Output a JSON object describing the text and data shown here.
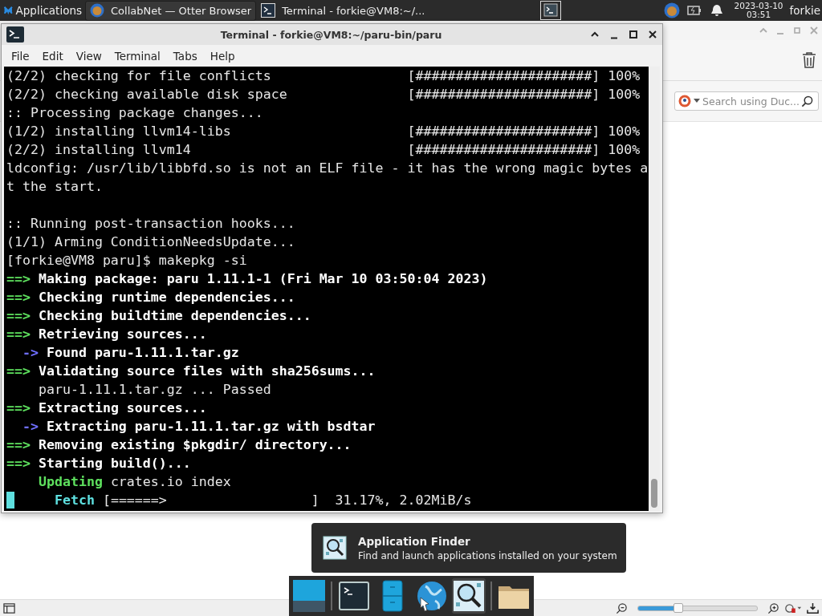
{
  "top_panel": {
    "apps_menu": "Applications",
    "tasks": [
      {
        "title": "CollabNet — Otter Browser",
        "kind": "browser",
        "selected": true
      },
      {
        "title": "Terminal - forkie@VM8:~/...",
        "kind": "terminal",
        "selected": false
      }
    ],
    "clock": {
      "date": "2023-03-10",
      "time": "03:51"
    },
    "user": "forkie"
  },
  "browser": {
    "search": {
      "placeholder": "Search using Duc..."
    },
    "zoom": {
      "level": 0.34
    }
  },
  "terminal": {
    "title": "Terminal - forkie@VM8:~/paru-bin/paru",
    "menu": [
      "File",
      "Edit",
      "View",
      "Terminal",
      "Tabs",
      "Help"
    ],
    "lines": [
      {
        "cursor": false,
        "segments": [
          {
            "text": "(2/2) checking for file conflicts                 [######################] 100%",
            "kind": "output"
          }
        ]
      },
      {
        "cursor": false,
        "segments": [
          {
            "text": "(2/2) checking available disk space               [######################] 100%",
            "kind": "output"
          }
        ]
      },
      {
        "cursor": false,
        "segments": [
          {
            "text": ":: Processing package changes...",
            "kind": "output"
          }
        ]
      },
      {
        "cursor": false,
        "segments": [
          {
            "text": "(1/2) installing llvm14-libs                      [######################] 100%",
            "kind": "output"
          }
        ]
      },
      {
        "cursor": false,
        "segments": [
          {
            "text": "(2/2) installing llvm14                           [######################] 100%",
            "kind": "output"
          }
        ]
      },
      {
        "cursor": false,
        "segments": [
          {
            "text": "ldconfig: /usr/lib/libbfd.so is not an ELF file - it has the wrong magic bytes a",
            "kind": "output"
          }
        ]
      },
      {
        "cursor": false,
        "segments": [
          {
            "text": "t the start.",
            "kind": "output"
          }
        ]
      },
      {
        "cursor": false
      },
      {
        "cursor": false,
        "segments": [
          {
            "text": ":: Running post-transaction hooks...",
            "kind": "output"
          }
        ]
      },
      {
        "cursor": false,
        "segments": [
          {
            "text": "(1/1) Arming ConditionNeedsUpdate...",
            "kind": "output"
          }
        ]
      },
      {
        "cursor": false,
        "segments": [
          {
            "text": "[forkie@VM8 paru]$ makepkg -si",
            "kind": "output"
          }
        ]
      },
      {
        "cursor": false,
        "segments": [
          {
            "text": "==>",
            "kind": "marker"
          },
          {
            "text": " Making package: paru 1.11.1-1 (Fri Mar 10 03:50:04 2023)",
            "kind": "heading"
          }
        ]
      },
      {
        "cursor": false,
        "segments": [
          {
            "text": "==>",
            "kind": "marker"
          },
          {
            "text": " Checking runtime dependencies...",
            "kind": "heading"
          }
        ]
      },
      {
        "cursor": false,
        "segments": [
          {
            "text": "==>",
            "kind": "marker"
          },
          {
            "text": " Checking buildtime dependencies...",
            "kind": "heading"
          }
        ]
      },
      {
        "cursor": false,
        "segments": [
          {
            "text": "==>",
            "kind": "marker"
          },
          {
            "text": " Retrieving sources...",
            "kind": "heading"
          }
        ]
      },
      {
        "cursor": false,
        "segments": [
          {
            "text": "  ->",
            "kind": "subarrow"
          },
          {
            "text": " Found paru-1.11.1.tar.gz",
            "kind": "heading"
          }
        ]
      },
      {
        "cursor": false,
        "segments": [
          {
            "text": "==>",
            "kind": "marker"
          },
          {
            "text": " Validating source files with sha256sums...",
            "kind": "heading"
          }
        ]
      },
      {
        "cursor": false,
        "segments": [
          {
            "text": "    paru-1.11.1.tar.gz ... Passed",
            "kind": "output"
          }
        ]
      },
      {
        "cursor": false,
        "segments": [
          {
            "text": "==>",
            "kind": "marker"
          },
          {
            "text": " Extracting sources...",
            "kind": "heading"
          }
        ]
      },
      {
        "cursor": false,
        "segments": [
          {
            "text": "  ->",
            "kind": "subarrow"
          },
          {
            "text": " Extracting paru-1.11.1.tar.gz with bsdtar",
            "kind": "heading"
          }
        ]
      },
      {
        "cursor": false,
        "segments": [
          {
            "text": "==>",
            "kind": "marker"
          },
          {
            "text": " Removing existing $pkgdir/ directory...",
            "kind": "heading"
          }
        ]
      },
      {
        "cursor": false,
        "segments": [
          {
            "text": "==>",
            "kind": "marker"
          },
          {
            "text": " Starting build()...",
            "kind": "heading"
          }
        ]
      },
      {
        "cursor": false,
        "segments": [
          {
            "text": "    Updating",
            "kind": "action"
          },
          {
            "text": " crates.io index",
            "kind": "output"
          }
        ]
      },
      {
        "cursor": true,
        "segments": [
          {
            "text": "      Fetch",
            "kind": "fetch"
          },
          {
            "text": " [======>                  ]  31.17%, 2.02MiB/s",
            "kind": "output"
          }
        ]
      }
    ]
  },
  "tooltip": {
    "title": "Application Finder",
    "description": "Find and launch applications installed on your system"
  },
  "dock": [
    {
      "kind": "desktop",
      "selected": false
    },
    {
      "kind": "terminal",
      "selected": false
    },
    {
      "kind": "cabinet",
      "selected": false
    },
    {
      "kind": "globe",
      "selected": false
    },
    {
      "kind": "finder",
      "selected": true
    },
    {
      "kind": "folder",
      "selected": false
    }
  ]
}
